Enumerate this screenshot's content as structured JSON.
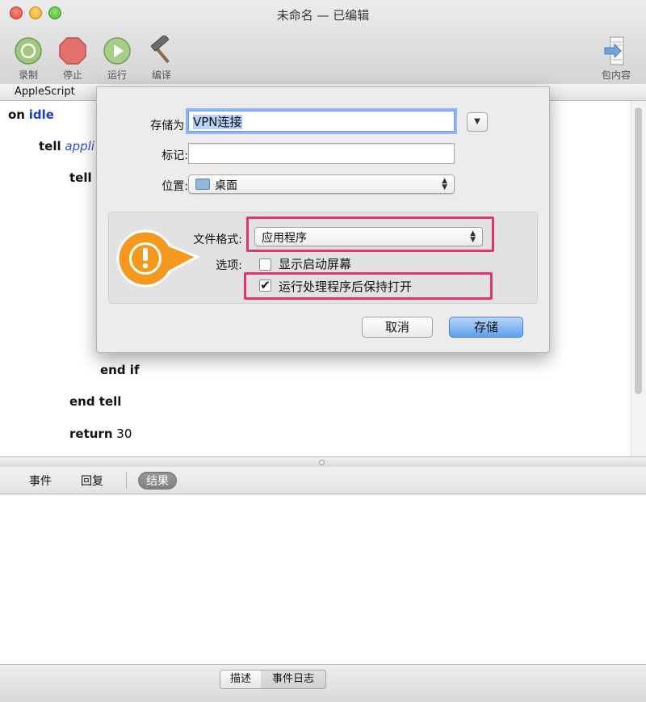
{
  "window": {
    "title": "未命名 — 已编辑"
  },
  "toolbar": {
    "record": "录制",
    "stop": "停止",
    "run": "运行",
    "compile": "编译",
    "bundle": "包内容"
  },
  "language": "AppleScript",
  "code": {
    "line1_kw": "on",
    "line1_word": "idle",
    "line2_kw": "tell",
    "line2_rest": "appli",
    "line3_kw": "tell",
    "line4_kw": "end if",
    "line5_kw": "end tell",
    "line6_kw": "return",
    "line6_num": "30"
  },
  "save_sheet": {
    "save_as_label": "存储为:",
    "save_as_value": "VPN连接",
    "tags_label": "标记:",
    "tags_value": "",
    "where_label": "位置:",
    "where_value": "桌面",
    "format_label": "文件格式:",
    "format_value": "应用程序",
    "options_label": "选项:",
    "option_splash": "显示启动屏幕",
    "option_splash_checked": false,
    "option_stay_open": "运行处理程序后保持打开",
    "option_stay_open_checked": true,
    "cancel": "取消",
    "save": "存储"
  },
  "result_tabs": {
    "events": "事件",
    "replies": "回复",
    "result": "结果"
  },
  "bottom_tabs": {
    "description": "描述",
    "event_log": "事件日志"
  },
  "colors": {
    "highlight": "#e5336c",
    "callout": "#f39a1e",
    "keyword_blue": "#1d3ccf"
  },
  "icons": [
    "record-icon",
    "stop-icon",
    "run-icon",
    "hammer-icon",
    "bundle-icon",
    "folder-icon",
    "warning-callout-icon"
  ]
}
